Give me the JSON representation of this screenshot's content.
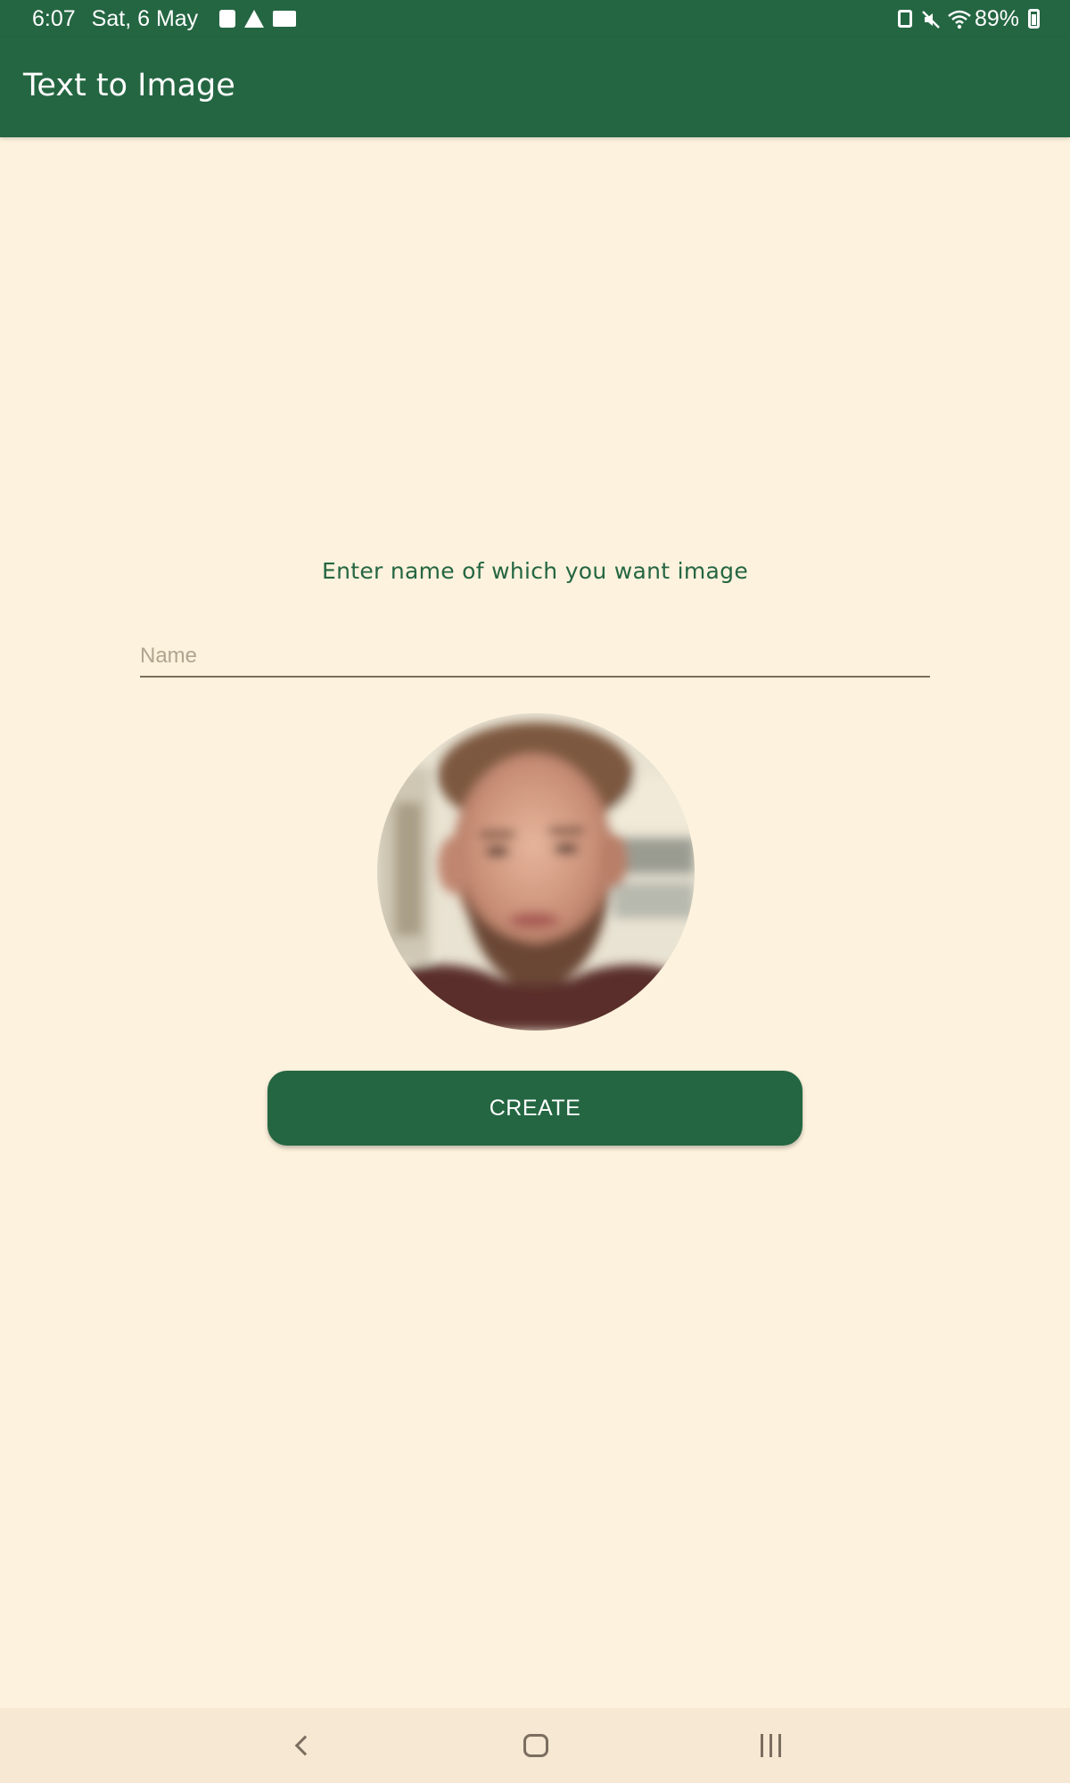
{
  "status_bar": {
    "time": "6:07",
    "date": "Sat, 6 May",
    "battery": "89%",
    "icons_left": [
      "note-icon",
      "warning-icon",
      "outlook-icon"
    ],
    "icons_right": [
      "shield-icon",
      "mute-icon",
      "wifi-icon",
      "battery-icon"
    ]
  },
  "app_bar": {
    "title": "Text to Image"
  },
  "main": {
    "prompt": "Enter name of which you want image",
    "name_field": {
      "placeholder": "Name",
      "value": ""
    },
    "create_label": "CREATE"
  },
  "nav_bar": {
    "buttons": [
      "back",
      "home",
      "recent-apps"
    ]
  },
  "colors": {
    "primary": "#246642",
    "background": "#fdf2dd",
    "nav_background": "#f6e8d2",
    "text_on_primary": "#ffffff"
  }
}
